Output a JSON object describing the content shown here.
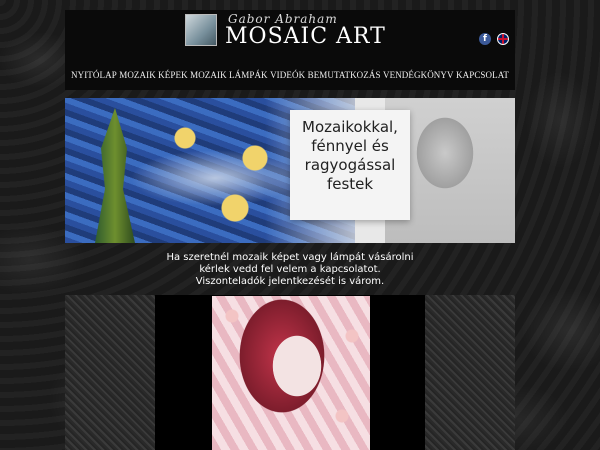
{
  "header": {
    "logo_subtitle": "Gabor Abraham",
    "logo_title": "MOSAIC ART",
    "icons": [
      "facebook-icon",
      "english-flag-icon"
    ]
  },
  "nav": {
    "items": [
      "NYITÓLAP",
      "MOZAIK KÉPEK",
      "MOZAIK LÁMPÁK",
      "VIDEÓK",
      "BEMUTATKOZÁS",
      "VENDÉGKÖNYV",
      "KAPCSOLAT"
    ]
  },
  "banner": {
    "line1": "Mozaikokkal,",
    "line2": "fénnyel és",
    "line3": "ragyogással",
    "line4": "festek"
  },
  "intro": {
    "line1": "Ha szeretnél mozaik képet vagy lámpát vásárolni",
    "line2": "kérlek vedd fel velem a kapcsolatot.",
    "line3": "Viszonteladók jelentkezését is várom."
  },
  "colors": {
    "background": "#1c1c1c",
    "header_bg": "#0a0a0a",
    "text": "#ffffff",
    "facebook": "#3b5998"
  }
}
